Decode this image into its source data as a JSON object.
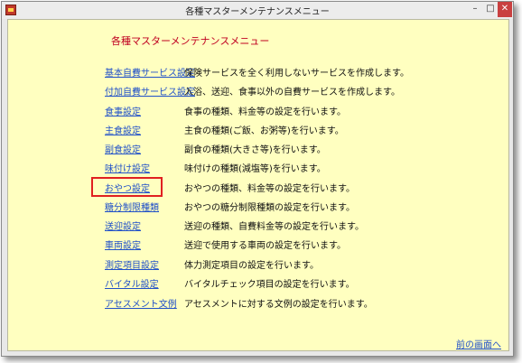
{
  "window": {
    "title": "各種マスターメンテナンスメニュー",
    "controls": {
      "minimize": "–",
      "maximize": "□",
      "close": "✕"
    }
  },
  "heading": "各種マスターメンテナンスメニュー",
  "menu": [
    {
      "label": "基本自費サービス設定",
      "description": "保険サービスを全く利用しないサービスを作成します。"
    },
    {
      "label": "付加自費サービス設定",
      "description": "入浴、送迎、食事以外の自費サービスを作成します。"
    },
    {
      "label": "食事設定",
      "description": "食事の種類、料金等の設定を行います。"
    },
    {
      "label": "主食設定",
      "description": "主食の種類(ご飯、お粥等)を行います。"
    },
    {
      "label": "副食設定",
      "description": "副食の種類(大きさ等)を行います。"
    },
    {
      "label": "味付け設定",
      "description": "味付けの種類(減塩等)を行います。"
    },
    {
      "label": "おやつ設定",
      "description": "おやつの種類、料金等の設定を行います。"
    },
    {
      "label": "糖分制限種類",
      "description": "おやつの糖分制限種類の設定を行います。"
    },
    {
      "label": "送迎設定",
      "description": "送迎の種類、自費料金等の設定を行います。"
    },
    {
      "label": "車両設定",
      "description": "送迎で使用する車両の設定を行います。"
    },
    {
      "label": "測定項目設定",
      "description": "体力測定項目の設定を行います。"
    },
    {
      "label": "バイタル設定",
      "description": "バイタルチェック項目の設定を行います。"
    },
    {
      "label": "アセスメント文例",
      "description": "アセスメントに対する文例の設定を行います。"
    }
  ],
  "back_link": "前の画面へ",
  "colors": {
    "background": "#ffffc0",
    "link": "#2050c8",
    "heading": "#c00020",
    "highlight": "#e02020"
  }
}
